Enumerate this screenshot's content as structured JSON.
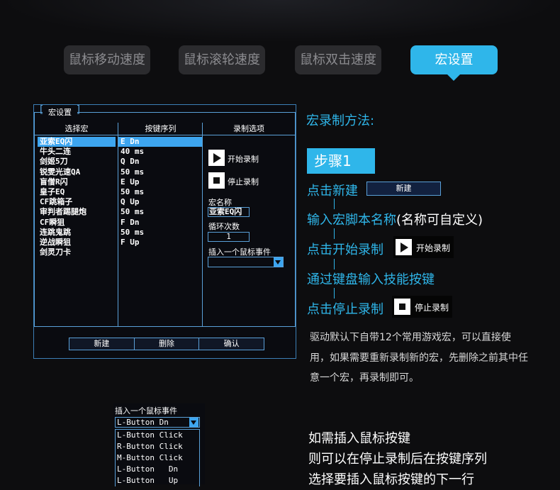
{
  "tabs": [
    {
      "label": "鼠标移动速度",
      "active": false
    },
    {
      "label": "鼠标滚轮速度",
      "active": false
    },
    {
      "label": "鼠标双击速度",
      "active": false
    },
    {
      "label": "宏设置",
      "active": true
    }
  ],
  "colors": {
    "accent": "#2fb6ea",
    "background": "#0d0d0f",
    "tab_inactive": "#2b2b2e",
    "border": "#5aa0d8",
    "selection": "#3da5ef"
  },
  "panel": {
    "title": "宏设置",
    "col_macro": "选择宏",
    "col_keys": "按键序列",
    "col_options": "录制选项",
    "macros": [
      "亚索EQ闪",
      "牛头二连",
      "剑姬5刀",
      "锐雯光速QA",
      "盲僧R闪",
      "皇子EQ",
      "CF跳箱子",
      "审判者踢腿炮",
      "CF瞬狙",
      "连跳鬼跳",
      "逆战瞬狙",
      "剑灵刀卡"
    ],
    "keys": [
      "E  Dn",
      "40 ms",
      "Q  Dn",
      "50 ms",
      "E  Up",
      "50 ms",
      "Q  Up",
      "50 ms",
      "F  Dn",
      "50 ms",
      "F  Up"
    ],
    "start_record": "开始录制",
    "stop_record": "停止录制",
    "macro_name_label": "宏名称",
    "macro_name_value": "亚索EQ闪",
    "loop_label": "循环次数",
    "loop_value": "1",
    "insert_label": "插入一个鼠标事件",
    "btn_new": "新建",
    "btn_delete": "删除",
    "btn_confirm": "确认"
  },
  "right": {
    "method_title": "宏录制方法:",
    "step_label": "步骤1",
    "s1": "点击新建",
    "new_btn": "新建",
    "s2": "输入宏脚本名称",
    "s2_note": "(名称可自定义)",
    "s3": "点击开始录制",
    "start_btn": "开始录制",
    "s4": "通过键盘输入技能按键",
    "s5": "点击停止录制",
    "stop_btn": "停止录制",
    "paragraph": "驱动默认下自带12个常用游戏宏，可以直接使用，如果需要重新录制新的宏，先删除之前其中任意一个宏，再录制即可。"
  },
  "dropdown": {
    "label": "插入一个鼠标事件",
    "selected": "L-Button   Dn",
    "options": [
      "L-Button Click",
      "R-Button Click",
      "M-Button Click",
      "L-Button   Dn",
      "L-Button   Up"
    ]
  },
  "bottom_text": [
    "如需插入鼠标按键",
    "则可以在停止录制后在按键序列",
    "选择要插入鼠标按键的下一行"
  ]
}
